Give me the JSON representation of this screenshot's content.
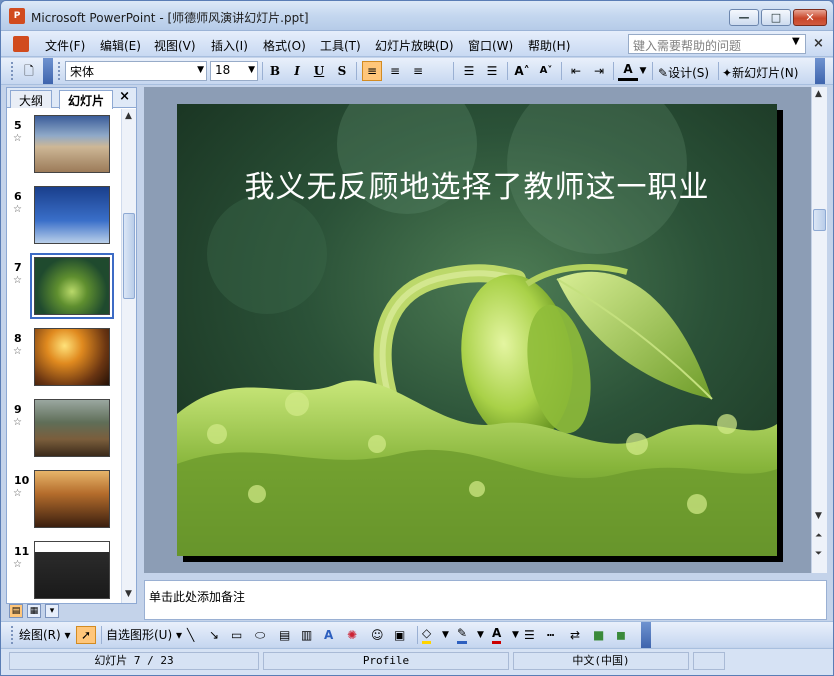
{
  "window": {
    "title": "Microsoft PowerPoint - [师德师风演讲幻灯片.ppt]",
    "app_icon": "powerpoint-icon"
  },
  "menubar": {
    "items": [
      "文件(F)",
      "编辑(E)",
      "视图(V)",
      "插入(I)",
      "格式(O)",
      "工具(T)",
      "幻灯片放映(D)",
      "窗口(W)",
      "帮助(H)"
    ],
    "help_placeholder": "键入需要帮助的问题"
  },
  "toolbar": {
    "font_name": "宋体",
    "font_size": "18",
    "bold": "B",
    "italic": "I",
    "underline": "U",
    "shadow": "S",
    "design_label": "设计(S)",
    "new_slide_label": "新幻灯片(N)",
    "active_alignment": "align-left"
  },
  "left_pane": {
    "tabs": [
      "大纲",
      "幻灯片"
    ],
    "selected_tab": "幻灯片",
    "close_glyph": "×",
    "thumbnails": [
      {
        "num": "5",
        "theme": "beach"
      },
      {
        "num": "6",
        "theme": "birds-sky"
      },
      {
        "num": "7",
        "theme": "sprout",
        "selected": true
      },
      {
        "num": "8",
        "theme": "sunset"
      },
      {
        "num": "9",
        "theme": "railway"
      },
      {
        "num": "10",
        "theme": "silhouette"
      },
      {
        "num": "11",
        "theme": "flowers-text"
      }
    ]
  },
  "slide": {
    "title": "我义无反顾地选择了教师这一职业",
    "background": "green-sprout-photo"
  },
  "notes": {
    "placeholder": "单击此处添加备注"
  },
  "drawbar": {
    "draw_label": "绘图(R)",
    "autoshapes_label": "自选图形(U)"
  },
  "status": {
    "slide_indicator": "幻灯片 7 / 23",
    "design_template": "Profile",
    "language": "中文(中国)"
  },
  "colors": {
    "accent_active": "#ffc67a",
    "close_button": "#c9462a",
    "toolbar_bg": "#c6d7f0"
  }
}
